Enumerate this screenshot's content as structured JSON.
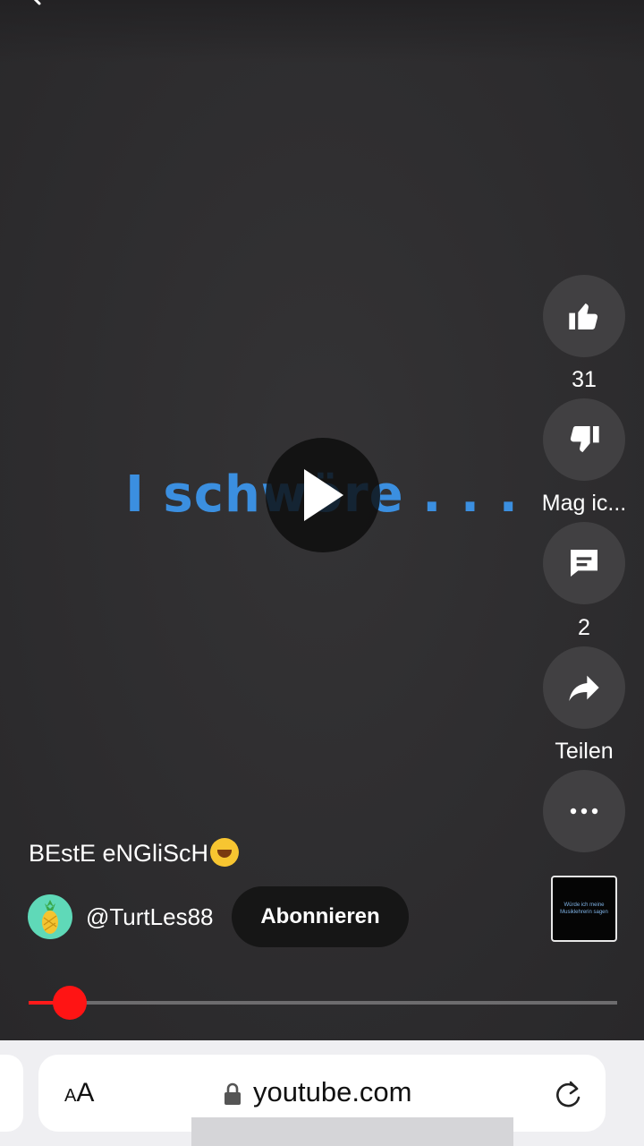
{
  "video": {
    "caption": "I schwöre . . .",
    "title": "BEstE eNGliScH",
    "title_emoji": "rolling-on-floor-laughing-emoji",
    "channel": "@TurtLes88",
    "subscribe_label": "Abonnieren",
    "progress_fraction": 0.07,
    "sound_thumbnail_text": "Würde ich meine Musiklehrerin sagen"
  },
  "actions": {
    "like_count": "31",
    "dislike_label": "Mag ic...",
    "comment_count": "2",
    "share_label": "Teilen"
  },
  "browser": {
    "text_size_label_small": "A",
    "text_size_label_big": "A",
    "url": "youtube.com"
  },
  "colors": {
    "accent_red": "#ff1414",
    "caption_blue": "#3b8fe0",
    "background": "#2f2e30"
  }
}
